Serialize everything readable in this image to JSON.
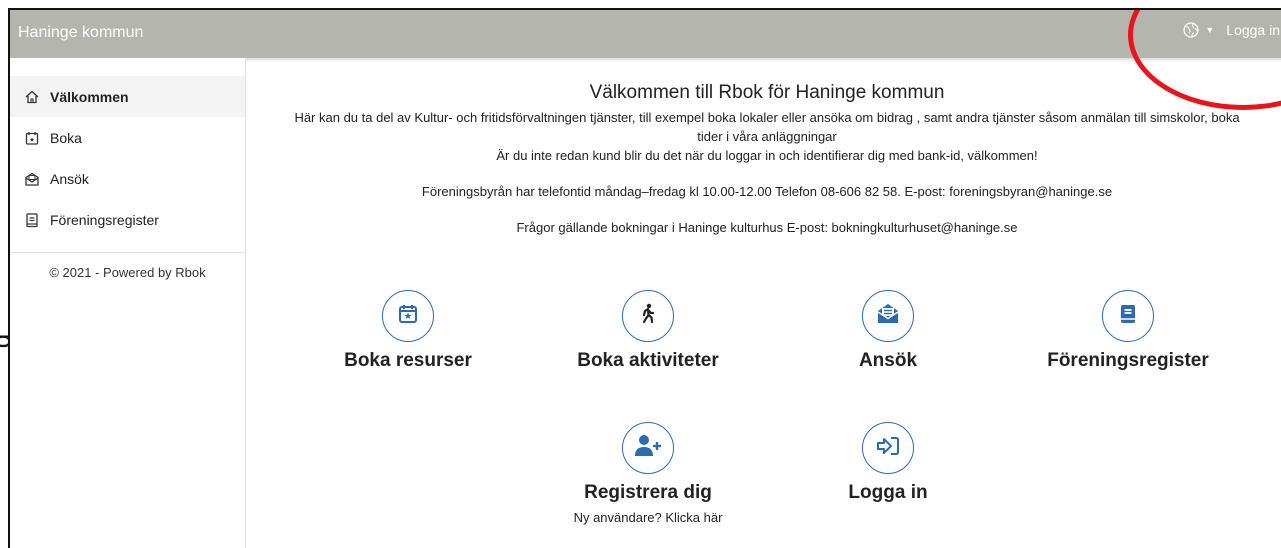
{
  "header": {
    "brand": "Haninge kommun",
    "language_icon": "globe-icon",
    "login_label": "Logga in"
  },
  "sidebar": {
    "items": [
      {
        "label": "Välkommen",
        "icon": "home-icon",
        "active": true
      },
      {
        "label": "Boka",
        "icon": "calendar-icon",
        "active": false
      },
      {
        "label": "Ansök",
        "icon": "envelope-open-icon",
        "active": false
      },
      {
        "label": "Föreningsregister",
        "icon": "book-icon",
        "active": false
      }
    ],
    "copyright": "© 2021 - Powered by Rbok"
  },
  "main": {
    "title": "Välkommen till Rbok för Haninge kommun",
    "intro_line1": "Här kan du ta del av Kultur- och fritidsförvaltningen tjänster, till exempel boka lokaler eller ansöka om bidrag , samt andra tjänster såsom anmälan till simskolor, boka",
    "intro_line2": "tider i våra anläggningar",
    "intro_line3": "Är du inte redan kund blir du det när du loggar in och identifierar dig med bank-id, välkommen!",
    "phone_info": "Föreningsbyrån har telefontid måndag–fredag kl 10.00-12.00 Telefon 08-606 82 58. E-post: foreningsbyran@haninge.se",
    "culture_info": "Frågor gällande bokningar i Haninge kulturhus E-post: bokningkulturhuset@haninge.se",
    "tiles": [
      {
        "label": "Boka resurser",
        "icon": "calendar-star-icon"
      },
      {
        "label": "Boka aktiviteter",
        "icon": "walking-person-icon"
      },
      {
        "label": "Ansök",
        "icon": "envelope-open-icon"
      },
      {
        "label": "Föreningsregister",
        "icon": "book-icon"
      },
      {
        "label": "Registrera dig",
        "icon": "user-plus-icon",
        "sub": "Ny användare? Klicka här"
      },
      {
        "label": "Logga in",
        "icon": "sign-in-icon"
      }
    ]
  },
  "annotation": {
    "color": "#e8141b",
    "edge_glyph": "g"
  },
  "colors": {
    "topbar": "#b5b5af",
    "accent": "#2b6cb0",
    "annotation_red": "#e8141b"
  }
}
